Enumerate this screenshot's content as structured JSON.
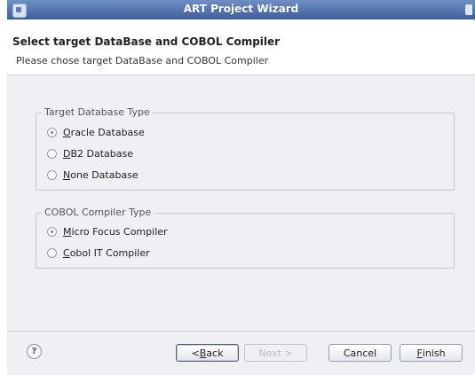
{
  "window": {
    "title": "ART Project Wizard"
  },
  "header": {
    "title": "Select target DataBase and COBOL Compiler",
    "description": "Please chose target DataBase and COBOL Compiler"
  },
  "database_group": {
    "legend": "Target Database Type",
    "options": [
      {
        "mnemonic": "O",
        "rest": "racle Database",
        "selected": true
      },
      {
        "mnemonic": "D",
        "rest": "B2 Database",
        "selected": false
      },
      {
        "mnemonic": "N",
        "rest": "one Database",
        "selected": false
      }
    ]
  },
  "compiler_group": {
    "legend": "COBOL Compiler Type",
    "options": [
      {
        "mnemonic": "M",
        "rest": "icro Focus Compiler",
        "selected": true
      },
      {
        "mnemonic": "C",
        "rest": "obol IT Compiler",
        "selected": false
      }
    ]
  },
  "buttons": {
    "back_prefix": "< ",
    "back_mnemonic": "B",
    "back_rest": "ack",
    "next_label": "Next >",
    "cancel_label": "Cancel",
    "finish_mnemonic": "F",
    "finish_rest": "inish"
  },
  "help": {
    "glyph": "?"
  }
}
